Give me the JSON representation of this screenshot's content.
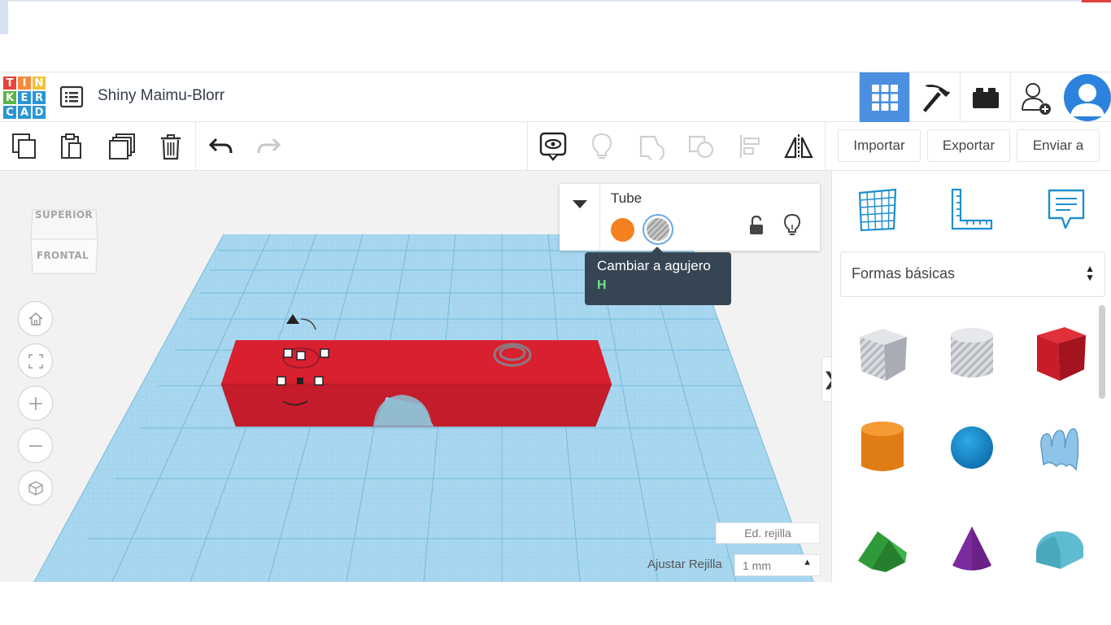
{
  "app": {
    "logo_letters": [
      "T",
      "I",
      "N",
      "K",
      "E",
      "R",
      "C",
      "A",
      "D"
    ],
    "logo_colors": [
      "#e8433a",
      "#f6883c",
      "#f2c13a",
      "#5bb548",
      "#2a95d6",
      "#2a95d6",
      "#2a95d6",
      "#2a95d6",
      "#2a95d6"
    ],
    "project_title": "Shiny Maimu-Blorr"
  },
  "header": {
    "buttons": [
      "3d-design-grid-view",
      "codeblocks-pickaxe",
      "bricks",
      "invite-user"
    ],
    "active_color": "#4b8fe0"
  },
  "toolbar": {
    "import_label": "Importar",
    "export_label": "Exportar",
    "send_label": "Enviar a"
  },
  "viewcube": {
    "top_label": "SUPERIOR",
    "front_label": "FRONTAL"
  },
  "inspector": {
    "shape_name": "Tube",
    "solid_color": "#f4811f",
    "hole_selected": true
  },
  "tooltip": {
    "text": "Cambiar a agujero",
    "shortcut": "H"
  },
  "grid": {
    "edit_label": "Ed. rejilla",
    "snap_label": "Ajustar Rejilla",
    "snap_value": "1 mm"
  },
  "panel": {
    "category": "Formas básicas",
    "shapes": [
      "box-hole",
      "cylinder-hole",
      "box",
      "cylinder",
      "sphere",
      "scribble",
      "roof",
      "cone",
      "round-roof"
    ]
  },
  "colors": {
    "workplane_blue": "#a9d7ef",
    "object_red": "#d9202f",
    "accent": "#2d82de"
  }
}
